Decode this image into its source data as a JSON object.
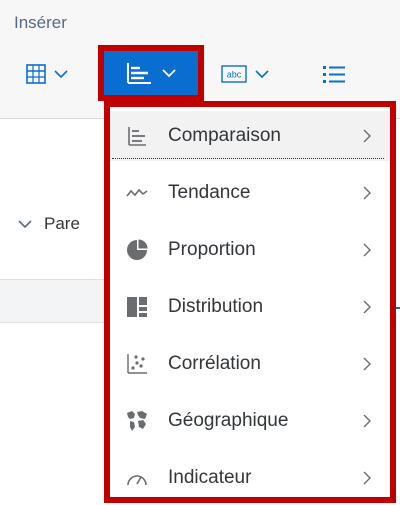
{
  "toolbar": {
    "section_title": "Insérer",
    "buttons": [
      {
        "name": "table-insert",
        "icon": "table-icon"
      },
      {
        "name": "chart-insert",
        "icon": "bar-chart-icon"
      },
      {
        "name": "text-insert",
        "icon": "text-box-icon",
        "icon_text": "abc"
      },
      {
        "name": "list-insert",
        "icon": "list-icon"
      }
    ]
  },
  "background": {
    "row_label": "Pare"
  },
  "menu": {
    "items": [
      {
        "label": "Comparaison",
        "icon": "comparison-icon",
        "focused": true
      },
      {
        "label": "Tendance",
        "icon": "trend-icon"
      },
      {
        "label": "Proportion",
        "icon": "pie-icon"
      },
      {
        "label": "Distribution",
        "icon": "distribution-icon"
      },
      {
        "label": "Corrélation",
        "icon": "scatter-icon"
      },
      {
        "label": "Géographique",
        "icon": "map-icon"
      },
      {
        "label": "Indicateur",
        "icon": "gauge-icon"
      }
    ]
  },
  "colors": {
    "accent": "#0a6ed1",
    "highlight_border": "#c00000",
    "icon_gray": "#6a6d70"
  }
}
